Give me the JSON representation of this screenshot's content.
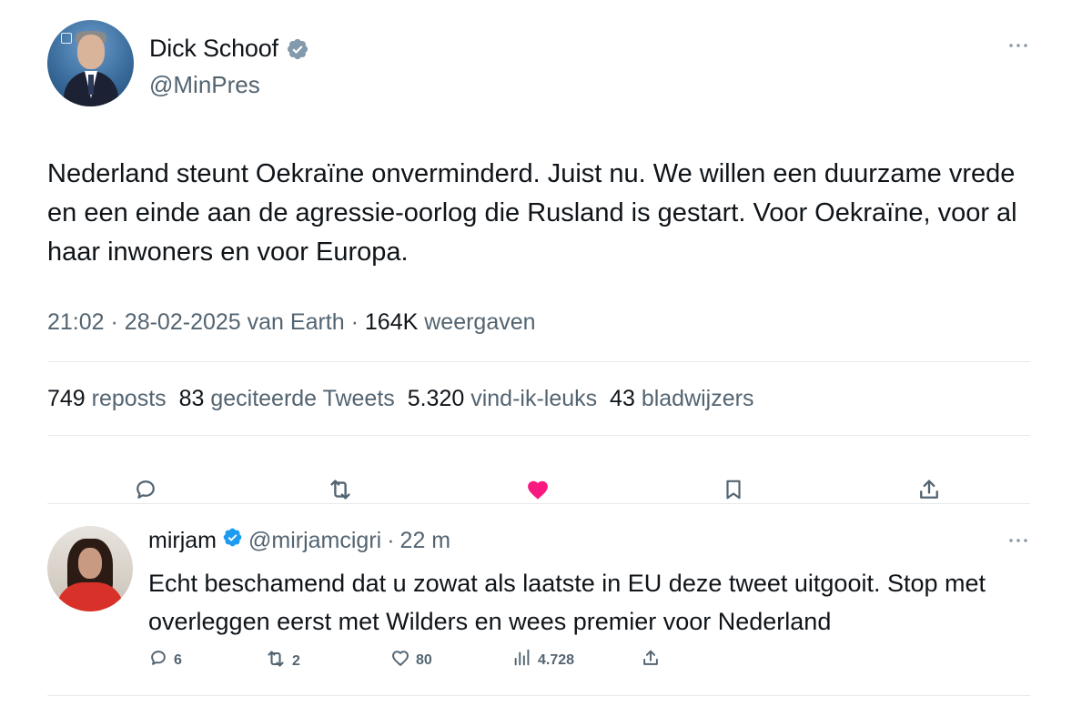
{
  "tweet": {
    "author_name": "Dick Schoof",
    "author_handle": "@MinPres",
    "text": "Nederland steunt Oekraïne onverminderd. Juist nu. We willen een duurzame vrede en een einde aan de agressie-oorlog die Rusland is gestart. Voor Oekraïne, voor al haar inwoners en voor Europa.",
    "time": "21:02",
    "date": "28-02-2025",
    "source": "van Earth",
    "views": "164K",
    "views_label": "weergaven",
    "stats": {
      "reposts": "749",
      "reposts_label": "reposts",
      "quotes": "83",
      "quotes_label": "geciteerde Tweets",
      "likes": "5.320",
      "likes_label": "vind-ik-leuks",
      "bookmarks": "43",
      "bookmarks_label": "bladwijzers"
    },
    "liked": true,
    "colors": {
      "like": "#f91880",
      "verified_author": "#829aab",
      "verified_reply": "#1d9bf0",
      "secondary_text": "#536471"
    }
  },
  "reply": {
    "author_name": "mirjam",
    "author_handle": "@mirjamcigri",
    "time": "22 m",
    "text": "Echt beschamend dat u zowat als laatste in EU deze tweet uitgooit. Stop met overleggen eerst met Wilders en wees premier voor Nederland",
    "replies": "6",
    "reposts": "2",
    "likes": "80",
    "views": "4.728"
  },
  "icons": [
    "verified-badge-icon",
    "more-icon",
    "reply-icon",
    "repost-icon",
    "like-icon",
    "bookmark-icon",
    "share-icon",
    "views-icon"
  ]
}
